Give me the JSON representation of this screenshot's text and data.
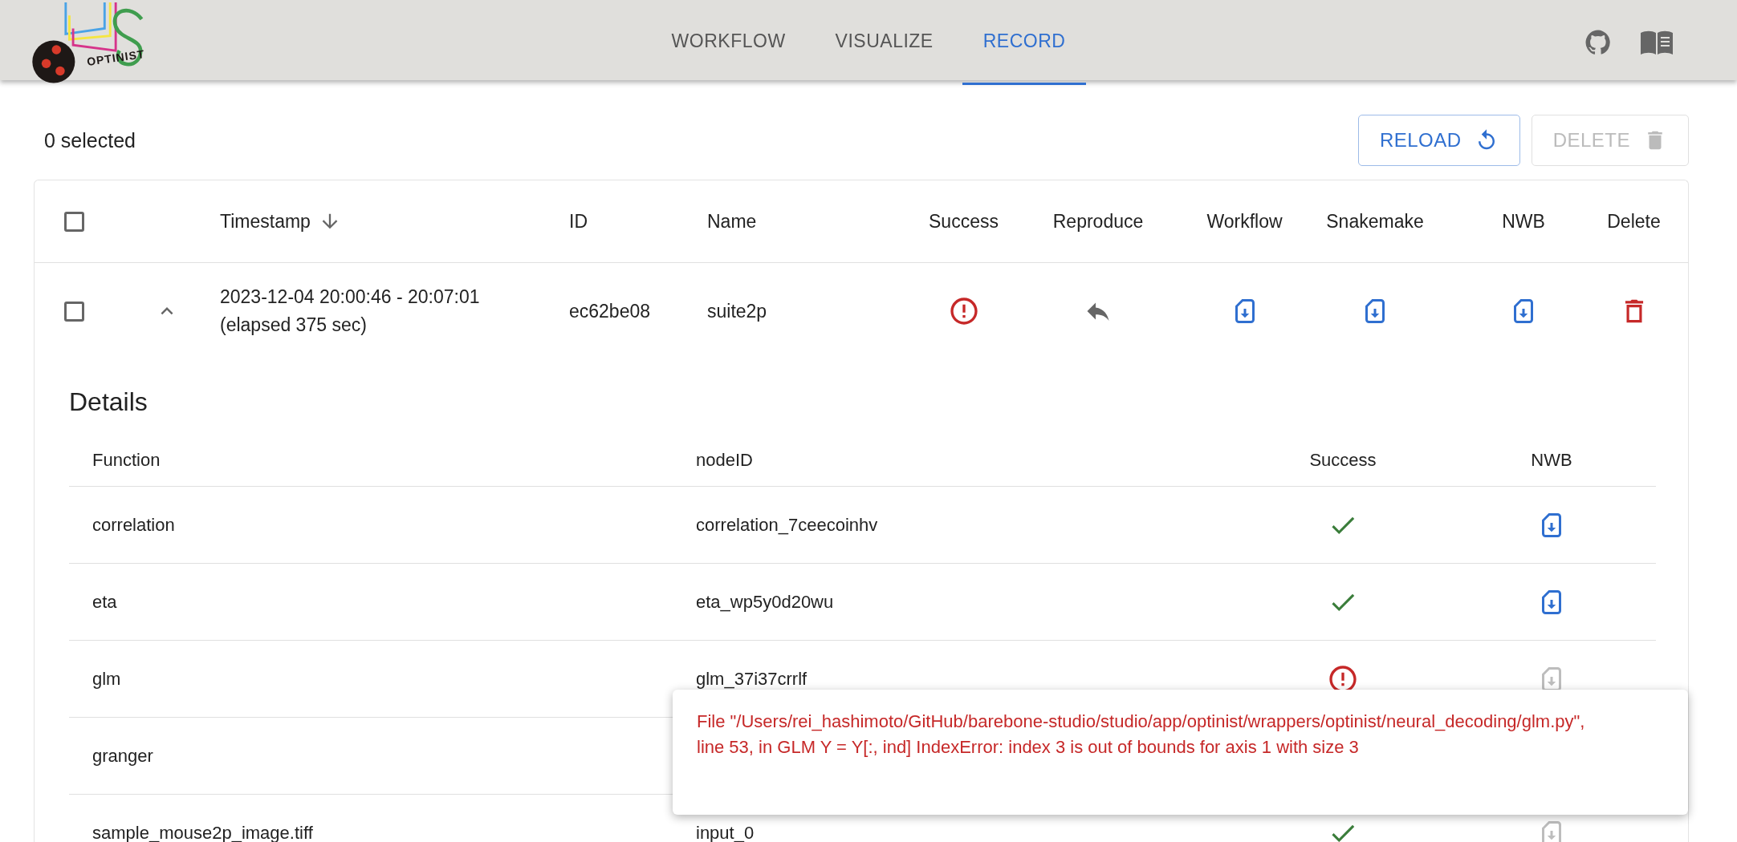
{
  "header": {
    "logo_text": "OPTINIST",
    "tabs": [
      {
        "label": "WORKFLOW",
        "selected": false
      },
      {
        "label": "VISUALIZE",
        "selected": false
      },
      {
        "label": "RECORD",
        "selected": true
      }
    ]
  },
  "toolbar": {
    "selected_count": "0 selected",
    "buttons": [
      {
        "label": "RELOAD",
        "kind": "reload",
        "disabled": false
      },
      {
        "label": "DELETE",
        "kind": "delete",
        "disabled": true
      }
    ]
  },
  "table": {
    "select_all_checked": false,
    "columns": [
      {
        "label": "Timestamp",
        "kind": "text",
        "sorted": true
      },
      {
        "label": "ID",
        "kind": "text",
        "sorted": false
      },
      {
        "label": "Name",
        "kind": "text",
        "sorted": false
      },
      {
        "label": "Success",
        "kind": "icon",
        "sorted": false
      },
      {
        "label": "Reproduce",
        "kind": "icon",
        "sorted": false
      },
      {
        "label": "Workflow",
        "kind": "icon",
        "sorted": false
      },
      {
        "label": "Snakemake",
        "kind": "icon",
        "sorted": false
      },
      {
        "label": "NWB",
        "kind": "icon",
        "sorted": false
      },
      {
        "label": "Delete",
        "kind": "icon",
        "sorted": false
      }
    ],
    "rows": [
      {
        "checked": false,
        "expanded": true,
        "timestamp": "2023-12-04 20:00:46 - 20:07:01",
        "elapsed": "(elapsed 375 sec)",
        "id": "ec62be08",
        "name": "suite2p",
        "success": false,
        "details": {
          "title": "Details",
          "columns": [
            "Function",
            "nodeID",
            "Success",
            "NWB"
          ],
          "rows": [
            {
              "function": "correlation",
              "node_id": "correlation_7ceecoinhv",
              "success": true,
              "nwb_available": true
            },
            {
              "function": "eta",
              "node_id": "eta_wp5y0d20wu",
              "success": true,
              "nwb_available": true
            },
            {
              "function": "glm",
              "node_id": "glm_37i37crrlf",
              "success": false,
              "nwb_available": false
            },
            {
              "function": "granger"
            },
            {
              "function": "sample_mouse2p_image.tiff",
              "node_id": "input_0",
              "success": true,
              "nwb_available": false
            }
          ]
        }
      }
    ]
  },
  "tooltip": {
    "text": "File \"/Users/rei_hashimoto/GitHub/barebone-studio/studio/app/optinist/wrappers/optinist/neural_decoding/glm.py\", line 53, in GLM Y = Y[:, ind] IndexError: index 3 is out of bounds for axis 1 with size 3"
  }
}
